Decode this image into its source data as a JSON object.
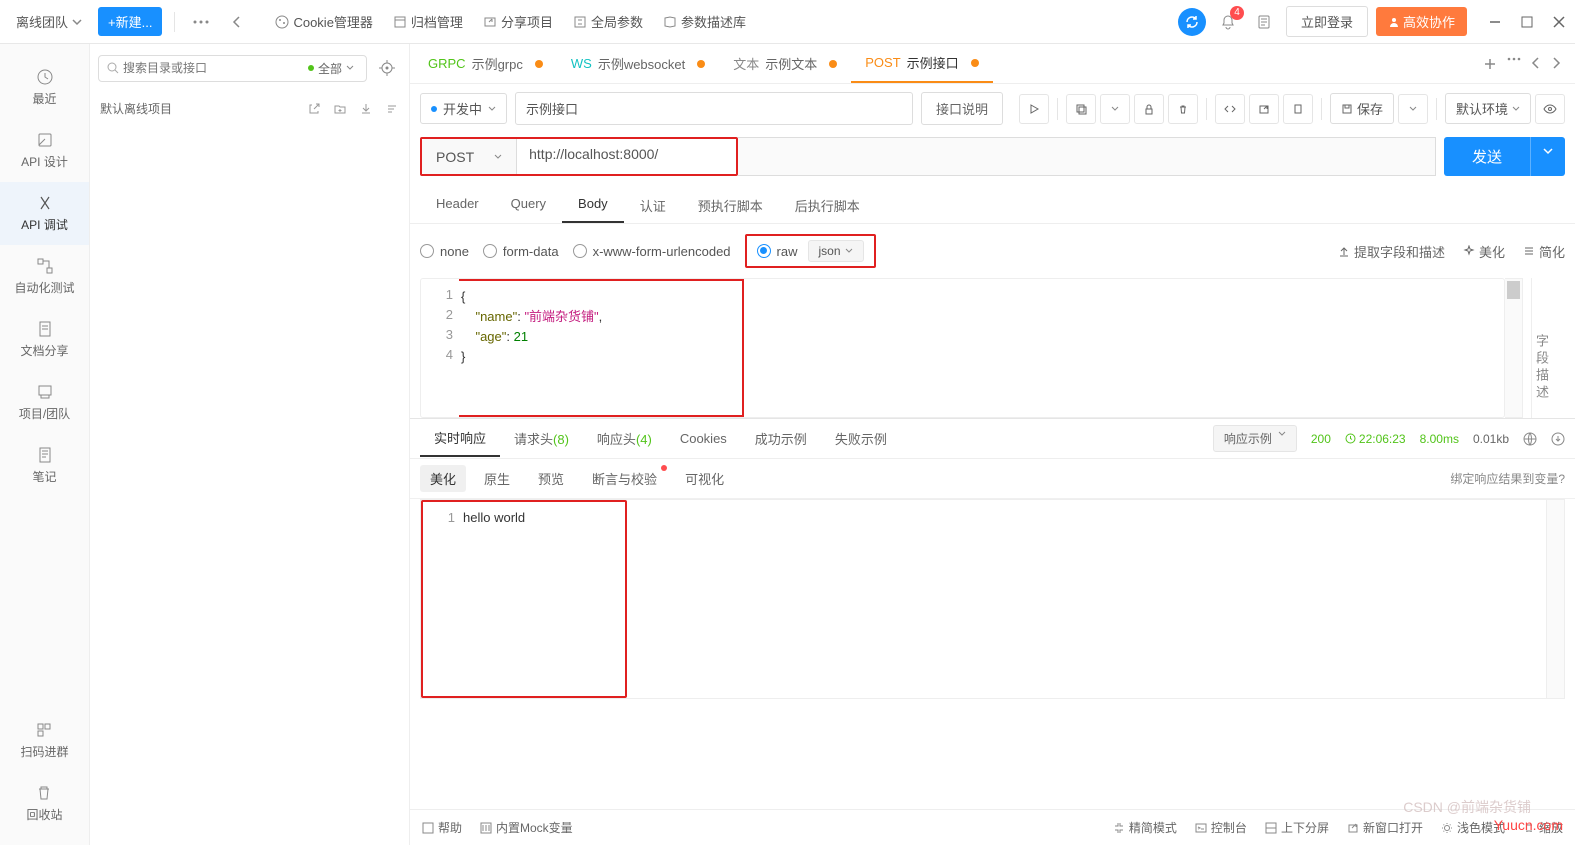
{
  "titlebar": {
    "team": "离线团队",
    "new_btn": "+新建...",
    "cookie_mgr": "Cookie管理器",
    "archive": "归档管理",
    "share": "分享项目",
    "global_params": "全局参数",
    "param_lib": "参数描述库",
    "notif_count": "4",
    "login": "立即登录",
    "collab": "高效协作"
  },
  "sidebar": {
    "items": [
      {
        "label": "最近"
      },
      {
        "label": "API 设计"
      },
      {
        "label": "API 调试"
      },
      {
        "label": "自动化测试"
      },
      {
        "label": "文档分享"
      },
      {
        "label": "项目/团队"
      },
      {
        "label": "笔记"
      }
    ],
    "scan": "扫码进群",
    "trash": "回收站"
  },
  "mid": {
    "search_placeholder": "搜索目录或接口",
    "filter_label": "全部",
    "project": "默认离线项目"
  },
  "tabs": [
    {
      "tag": "GRPC",
      "tag_class": "tag",
      "name": "示例grpc",
      "dirty": true
    },
    {
      "tag": "WS",
      "tag_class": "tag-ws",
      "name": "示例websocket",
      "dirty": true
    },
    {
      "tag": "文本",
      "tag_class": "tag-text",
      "name": "示例文本",
      "dirty": true
    },
    {
      "tag": "POST",
      "tag_class": "tag-post",
      "name": "示例接口",
      "dirty": true,
      "active": true
    }
  ],
  "request": {
    "status": "开发中",
    "name": "示例接口",
    "desc_btn": "接口说明",
    "save_btn": "保存",
    "env": "默认环境",
    "method": "POST",
    "url": "http://localhost:8000/",
    "send": "发送"
  },
  "req_tabs": [
    "Header",
    "Query",
    "Body",
    "认证",
    "预执行脚本",
    "后执行脚本"
  ],
  "req_tab_active": 2,
  "body_types": [
    "none",
    "form-data",
    "x-www-form-urlencoded",
    "raw"
  ],
  "body_type_selected": 3,
  "raw_format": "json",
  "body_actions": {
    "extract": "提取字段和描述",
    "beautify": "美化",
    "simplify": "简化"
  },
  "body_lines": [
    "{",
    "    \"name\": \"前端杂货铺\",",
    "    \"age\": 21",
    "}"
  ],
  "field_desc_label": "字段描述",
  "resp_tabs": {
    "realtime": "实时响应",
    "req_headers": "请求头",
    "req_headers_count": "(8)",
    "resp_headers": "响应头",
    "resp_headers_count": "(4)",
    "cookies": "Cookies",
    "success": "成功示例",
    "fail": "失败示例"
  },
  "resp_right": {
    "example": "响应示例",
    "code": "200",
    "time": "22:06:23",
    "duration": "8.00ms",
    "size": "0.01kb"
  },
  "resp_subtabs": [
    "美化",
    "原生",
    "预览",
    "断言与校验",
    "可视化"
  ],
  "resp_bind": "绑定响应结果到变量?",
  "resp_body": "hello world",
  "bottom": {
    "help": "帮助",
    "mock": "内置Mock变量",
    "simple": "精简模式",
    "console": "控制台",
    "split": "上下分屏",
    "newwin": "新窗口打开",
    "light": "浅色模式",
    "zoom": "缩放"
  },
  "watermark1": "Yuucn.com",
  "watermark2": "CSDN @前端杂货铺"
}
